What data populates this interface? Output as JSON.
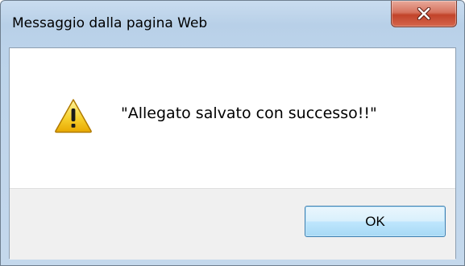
{
  "dialog": {
    "title": "Messaggio dalla pagina Web",
    "message": "\"Allegato salvato con successo!!\"",
    "ok_label": "OK",
    "icon": "warning-icon",
    "close_icon": "close-icon"
  },
  "colors": {
    "close_button": "#c7452d",
    "warning_yellow": "#f5c400",
    "button_area": "#f0f0f0"
  }
}
